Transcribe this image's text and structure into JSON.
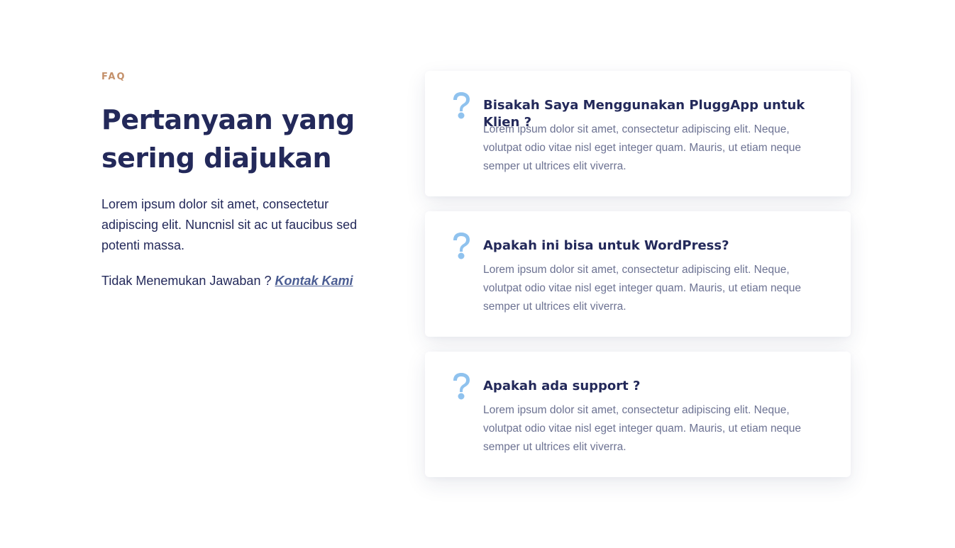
{
  "intro": {
    "eyebrow": "FAQ",
    "title": "Pertanyaan yang sering diajukan",
    "description": "Lorem ipsum dolor sit amet, consectetur adipiscing elit. Nuncnisl sit ac ut faucibus sed potenti massa.",
    "contact_prefix": "Tidak Menemukan Jawaban ?",
    "contact_link": "Kontak Kami"
  },
  "colors": {
    "eyebrow": "#c4906a",
    "heading": "#23295a",
    "body_text": "#6c7292",
    "link": "#4b5d93",
    "icon": "#8fc2ee"
  },
  "faqs": [
    {
      "icon": "question-mark-icon",
      "question": "Bisakah Saya Menggunakan PluggApp untuk Klien ?",
      "answer": "Lorem ipsum dolor sit amet, consectetur adipiscing elit. Neque, volutpat odio vitae nisl eget integer quam. Mauris, ut etiam neque semper ut ultrices elit viverra."
    },
    {
      "icon": "question-mark-icon",
      "question": "Apakah ini bisa untuk WordPress?",
      "answer": "Lorem ipsum dolor sit amet, consectetur adipiscing elit. Neque, volutpat odio vitae nisl eget integer quam. Mauris, ut etiam neque semper ut ultrices elit viverra."
    },
    {
      "icon": "question-mark-icon",
      "question": "Apakah ada support ?",
      "answer": "Lorem ipsum dolor sit amet, consectetur adipiscing elit. Neque, volutpat odio vitae nisl eget integer quam. Mauris, ut etiam neque semper ut ultrices elit viverra."
    }
  ]
}
